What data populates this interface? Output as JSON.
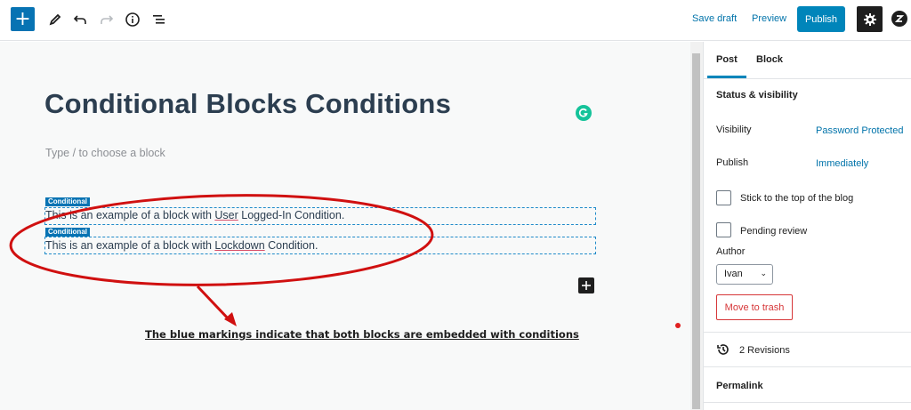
{
  "toolbar": {
    "add_icon": "plus-icon",
    "save_draft": "Save draft",
    "preview": "Preview",
    "publish": "Publish"
  },
  "editor": {
    "title": "Conditional Blocks Conditions",
    "placeholder": "Type / to choose a block",
    "blocks": [
      {
        "label": "Conditional",
        "text_before": "This is an example of a block with ",
        "text_underlined": "User",
        "text_after": " Logged-In Condition."
      },
      {
        "label": "Conditional",
        "text_before": "This is an example of a block with ",
        "text_underlined": "Lockdown",
        "text_after": " Condition."
      }
    ],
    "annotation": "The blue markings indicate that both blocks are embedded with conditions",
    "annotation_color": "#d01010"
  },
  "sidebar": {
    "tabs": [
      "Post",
      "Block"
    ],
    "status_title": "Status & visibility",
    "visibility_label": "Visibility",
    "visibility_value": "Password Protected",
    "publish_label": "Publish",
    "publish_value": "Immediately",
    "stick_label": "Stick to the top of the blog",
    "pending_label": "Pending review",
    "author_label": "Author",
    "author_value": "Ivan",
    "trash_label": "Move to trash",
    "revisions_label": "2 Revisions",
    "permalink_label": "Permalink"
  }
}
